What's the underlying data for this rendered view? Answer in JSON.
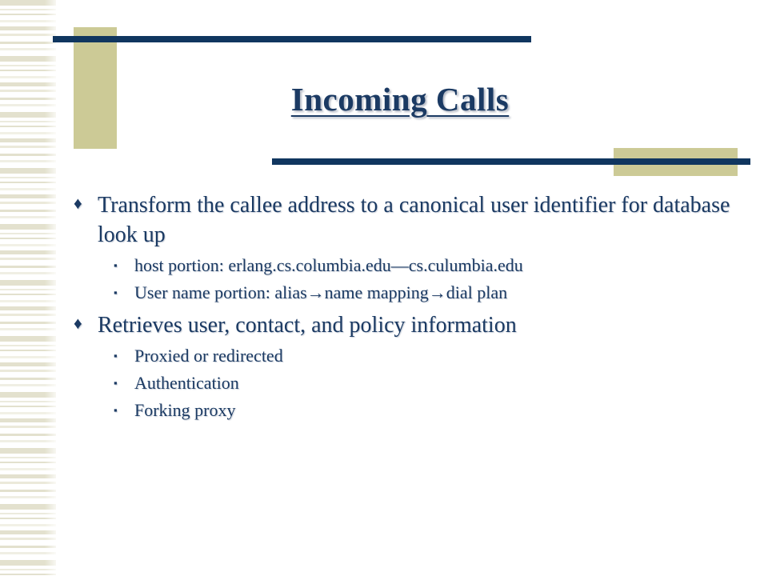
{
  "slide": {
    "title": "Incoming Calls",
    "colors": {
      "title_text": "#1b3a63",
      "body_text": "#1b3a63",
      "accent_navy": "#10365f",
      "accent_khaki": "#ccca96",
      "stripe_khaki": "#e3e1ce",
      "background": "#ffffff"
    },
    "bullet_glyphs": {
      "level1": "♦",
      "level2": "▪"
    },
    "content": [
      {
        "level1": "Transform the callee address to a canonical user identifier for database look up",
        "level2": [
          "host portion:  erlang.cs.columbia.edu—cs.culumbia.edu",
          "User name portion: alias→name mapping→dial plan"
        ]
      },
      {
        "level1": "Retrieves user, contact, and policy information",
        "level2": [
          "Proxied or redirected",
          "Authentication",
          "Forking proxy"
        ]
      }
    ]
  }
}
